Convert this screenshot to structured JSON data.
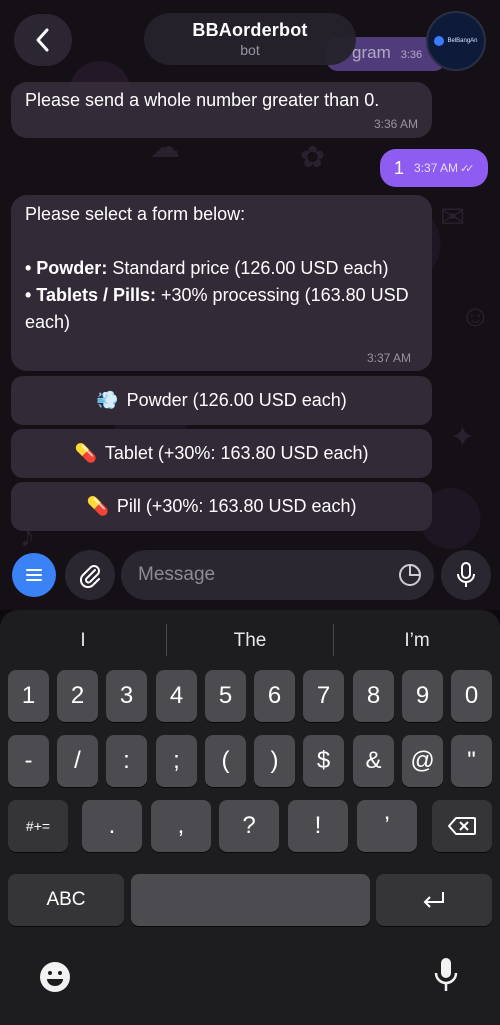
{
  "header": {
    "bot_name": "BBAorderbot",
    "bot_subtitle": "bot",
    "avatar_text": "BelBangAn",
    "peek_text": "gram",
    "peek_time": "3:36"
  },
  "messages": {
    "m1": {
      "text": "Please send a whole number greater than 0.",
      "time": "3:36 AM"
    },
    "m2": {
      "text": "1",
      "time": "3:37 AM",
      "read_icon": "double-check-icon"
    },
    "m3": {
      "line1": "Please select a form below:",
      "b1_bold": "• Powder:",
      "b1_rest": " Standard price (126.00 USD each)",
      "b2_bold": "• Tablets / Pills:",
      "b2_rest": " +30% processing (163.80 USD each)",
      "time": "3:37 AM"
    }
  },
  "inline_buttons": [
    {
      "emoji": "💨",
      "label": "Powder (126.00 USD each)"
    },
    {
      "emoji": "💊",
      "label": "Tablet (+30%: 163.80 USD each)"
    },
    {
      "emoji": "💊",
      "label": "Pill (+30%: 163.80 USD each)"
    }
  ],
  "input": {
    "placeholder": "Message"
  },
  "keyboard": {
    "suggestions": [
      "I",
      "The",
      "I’m"
    ],
    "row1": [
      "1",
      "2",
      "3",
      "4",
      "5",
      "6",
      "7",
      "8",
      "9",
      "0"
    ],
    "row2": [
      "-",
      "/",
      ":",
      ";",
      "(",
      ")",
      "$",
      "&",
      "@",
      "\""
    ],
    "row3_toggle": "#+=",
    "row3": [
      ".",
      ",",
      "?",
      "!",
      "’"
    ],
    "abc": "ABC"
  },
  "colors": {
    "accent": "#8e5cf0",
    "menu_button": "#3b82f6"
  }
}
